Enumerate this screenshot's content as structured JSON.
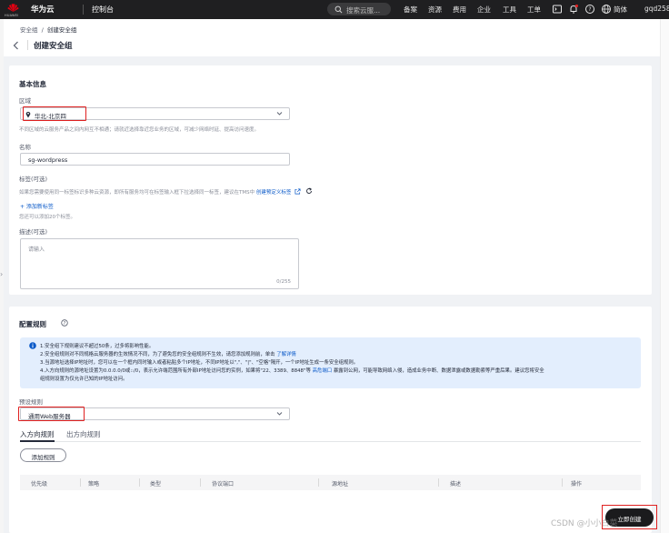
{
  "colors": {
    "topbar_bg": "#1f1f21",
    "link": "#0a59c8",
    "highlight": "#e02020",
    "info_bg": "#e3eefd"
  },
  "topbar": {
    "logo_text": "HUAWEI",
    "brand": "华为云",
    "console": "控制台",
    "search_placeholder": "搜索云服...",
    "links": [
      "备案",
      "资源",
      "费用",
      "企业",
      "工具",
      "工单"
    ],
    "lang": "简体",
    "user": "gqd258"
  },
  "breadcrumb": {
    "parent": "安全组",
    "separator": "/",
    "current": "创建安全组"
  },
  "page_title": "创建安全组",
  "basic": {
    "title": "基本信息",
    "region_label": "区域",
    "region_value": "华北-北京四",
    "region_hint": "不同区域的云服务产品之间内网互不相通；请就近选择靠近您业务的区域，可减少网络时延、提高访问速度。",
    "name_label": "名称",
    "name_value": "sg-wordpress",
    "tag_label": "标签(可选)",
    "tag_hint": "如果您需要使用同一标签标识多种云资源，即所有服务均可在标签输入框下拉选择同一标签，建议在TMS中",
    "tag_link": "创建预定义标签",
    "add_tag": "+ 添加新标签",
    "tag_limit": "您还可以添加20个标签。",
    "desc_label": "描述(可选)",
    "desc_placeholder": "请输入",
    "desc_count": "0/255"
  },
  "rules": {
    "title": "配置规则",
    "info": {
      "line1": "1.安全组下规则建议不超过50条，过多将影响性能。",
      "line2": "2.安全组规则对不同规格云服务器的生效情况不同，为了避免您的安全组规则不生效，请您添加规则前，单击",
      "line2_link": "了解详情",
      "line3": "3.当源地址选择IP地址时，您可以在一个框内同时输入或者粘贴多个IP地址，不同IP地址以\",\"、\"|\"、\"空格\"隔开，一个IP地址生成一条安全组规则。",
      "line4": "4.入方向规则的源地址设置为0.0.0.0/0或::/0，表示允许端范围所有外部IP地址访问您的实例，如果将\"22、3389、8848\"等",
      "line4_link": "高危端口",
      "line4_tail": "暴露到公网，可能导致网络入侵，造成业务中断、数据泄露或数据勒索等严重后果。建议您将安全",
      "line5": "组规则设置为仅允许已知的IP地址访问。"
    },
    "preset_label": "预设规则",
    "preset_value": "通用Web服务器",
    "tabs": [
      "入方向规则",
      "出方向规则"
    ],
    "add_rule": "添加规则",
    "columns": [
      "优先级",
      "策略",
      "类型",
      "协议端口",
      "源地址",
      "描述",
      "操作"
    ]
  },
  "footer_button": "立即创建",
  "watermark": "CSDN @小小白菜"
}
